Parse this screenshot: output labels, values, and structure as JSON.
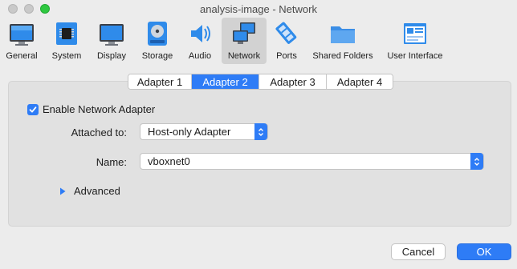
{
  "window": {
    "title": "analysis-image - Network"
  },
  "toolbar": {
    "items": [
      {
        "label": "General",
        "icon": "general-icon"
      },
      {
        "label": "System",
        "icon": "system-icon"
      },
      {
        "label": "Display",
        "icon": "display-icon"
      },
      {
        "label": "Storage",
        "icon": "storage-icon"
      },
      {
        "label": "Audio",
        "icon": "audio-icon"
      },
      {
        "label": "Network",
        "icon": "network-icon",
        "active": true
      },
      {
        "label": "Ports",
        "icon": "ports-icon"
      },
      {
        "label": "Shared Folders",
        "icon": "shared-folders-icon"
      },
      {
        "label": "User Interface",
        "icon": "user-interface-icon"
      }
    ]
  },
  "tabs": [
    {
      "label": "Adapter 1"
    },
    {
      "label": "Adapter 2",
      "active": true
    },
    {
      "label": "Adapter 3"
    },
    {
      "label": "Adapter 4"
    }
  ],
  "adapter": {
    "enable_label": "Enable Network Adapter",
    "enabled": true,
    "attached_to_label": "Attached to:",
    "attached_to_value": "Host-only Adapter",
    "name_label": "Name:",
    "name_value": "vboxnet0",
    "advanced_label": "Advanced"
  },
  "buttons": {
    "cancel": "Cancel",
    "ok": "OK"
  },
  "colors": {
    "accent": "#2e7cf6",
    "window_bg": "#ececec"
  }
}
